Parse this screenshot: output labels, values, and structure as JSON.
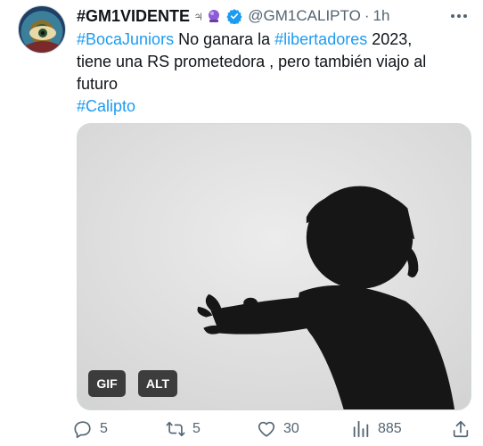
{
  "tweet": {
    "display_name": "#GM1VIDENTE",
    "name_suffix": "♃",
    "handle": "@GM1CALIPTO",
    "separator": "·",
    "time": "1h",
    "text": {
      "line1_tag1": "#BocaJuniors",
      "line1_mid": " No ganara la ",
      "line1_tag2": "#libertadores",
      "line1_end": " 2023,",
      "line2": "tiene una RS prometedora , pero también viajo al",
      "line3": "futuro",
      "line4_tag": "#Calipto"
    },
    "media": {
      "gif_label": "GIF",
      "alt_label": "ALT"
    },
    "actions": {
      "reply_count": "5",
      "retweet_count": "5",
      "like_count": "30",
      "view_count": "885"
    }
  },
  "colors": {
    "link": "#1d9bf0",
    "secondary_text": "#536471",
    "verified": "#1d9bf0"
  },
  "icons": {
    "more": "more-icon",
    "verified": "verified-badge-icon",
    "reply": "reply-icon",
    "retweet": "retweet-icon",
    "like": "heart-icon",
    "views": "views-icon",
    "share": "share-icon"
  }
}
